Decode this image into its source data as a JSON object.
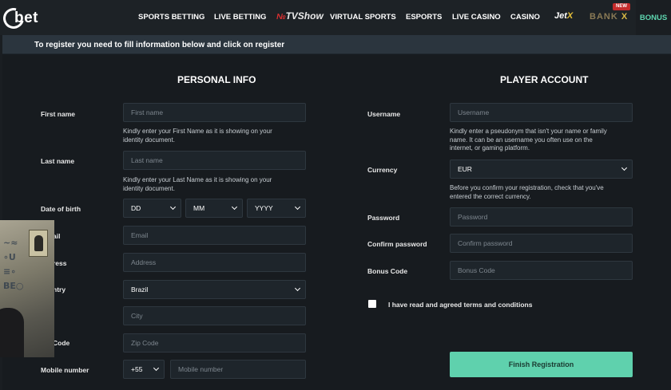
{
  "nav": {
    "logo": "bet",
    "items": [
      "SPORTS BETTING",
      "LIVE BETTING",
      "VIRTUAL SPORTS",
      "ESPORTS",
      "LIVE CASINO",
      "CASINO"
    ],
    "tvshow_pre": "№",
    "tvshow": "TVShow",
    "jetx_pre": "Jet",
    "jetx_x": "X",
    "bankx_pre": "BANK ",
    "bankx_x": "X",
    "new_badge": "NEW",
    "bonus": "BONUS"
  },
  "infobar": {
    "text": "To register you need to fill information below and click on register"
  },
  "personal": {
    "title": "PERSONAL INFO",
    "first_name_label": "First name",
    "first_name_placeholder": "First name",
    "first_name_hint_1": "Kindly enter your First Name as it is showing on your",
    "first_name_hint_2": "identity document.",
    "last_name_label": "Last name",
    "last_name_placeholder": "Last name",
    "last_name_hint_1": "Kindly enter your Last Name as it is showing on your",
    "last_name_hint_2": "identity document.",
    "dob_label": "Date of birth",
    "dob_day": "DD",
    "dob_month": "MM",
    "dob_year": "YYYY",
    "email_label": "ail",
    "email_placeholder": "Email",
    "address_label": "ress",
    "address_placeholder": "Address",
    "country_label": "ntry",
    "country_value": "Brazil",
    "city_placeholder": "City",
    "zip_label": "Code",
    "zip_placeholder": "Zip Code",
    "mobile_label": "Mobile number",
    "mobile_code": "+55",
    "mobile_placeholder": "Mobile number"
  },
  "account": {
    "title": "PLAYER ACCOUNT",
    "username_label": "Username",
    "username_placeholder": "Username",
    "username_hint_1": "Kindly enter a pseudonym that isn't your name or family",
    "username_hint_2": "name. It can be an username you often use on the",
    "username_hint_3": "internet, or gaming platform.",
    "currency_label": "Currency",
    "currency_value": "EUR",
    "currency_hint_1": "Before you confirm your registration, check that you've",
    "currency_hint_2": "entered the correct currency.",
    "password_label": "Password",
    "password_placeholder": "Password",
    "confirm_label": "Confirm password",
    "confirm_placeholder": "Confirm password",
    "bonus_label": "Bonus Code",
    "bonus_placeholder": "Bonus Code",
    "terms": "I have read and agreed terms and conditions",
    "finish": "Finish Registration"
  },
  "colors": {
    "accent": "#5fd1ad",
    "background": "#171b1f",
    "field": "#1e252b",
    "infobar": "#2b353e"
  }
}
